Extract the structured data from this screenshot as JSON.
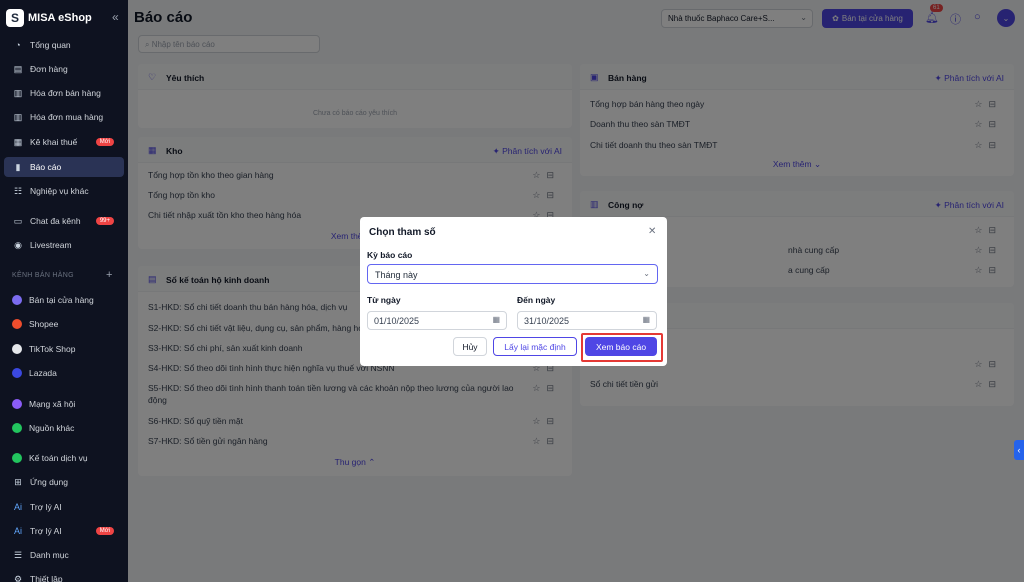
{
  "brand": {
    "logo_letter": "S",
    "name": "MISA eShop"
  },
  "sidebar": {
    "collapse_glyph": "«",
    "items": [
      {
        "label": "Tổng quan",
        "icon": "dashboard-icon"
      },
      {
        "label": "Đơn hàng",
        "icon": "order-icon"
      },
      {
        "label": "Hóa đơn bán hàng",
        "icon": "sales-invoice-icon"
      },
      {
        "label": "Hóa đơn mua hàng",
        "icon": "purchase-invoice-icon"
      },
      {
        "label": "Kê khai thuế",
        "icon": "tax-icon",
        "badge": "Mới"
      },
      {
        "label": "Báo cáo",
        "icon": "report-icon",
        "active": true
      },
      {
        "label": "Nghiệp vụ khác",
        "icon": "operations-icon"
      },
      {
        "label": "Chat đa kênh",
        "icon": "chat-icon",
        "badge": "99+"
      },
      {
        "label": "Livestream",
        "icon": "livestream-icon"
      }
    ],
    "section_label": "KÊNH BÁN HÀNG",
    "channels": [
      {
        "label": "Bán tại cửa hàng",
        "color": "#7c6cf0"
      },
      {
        "label": "Shopee",
        "color": "#ee4d2d"
      },
      {
        "label": "TikTok Shop",
        "color": "#e5e7eb"
      },
      {
        "label": "Lazada",
        "color": "#3b48e0"
      },
      {
        "label": "Mạng xã hội",
        "color": "#8b5cf6"
      },
      {
        "label": "Nguồn khác",
        "color": "#22c55e"
      }
    ],
    "bottom": [
      {
        "label": "Kế toán dịch vụ",
        "icon": "accounting-icon"
      },
      {
        "label": "Ứng dụng",
        "icon": "apps-icon"
      },
      {
        "label": "Trợ lý AI",
        "icon": "ai-assistant-icon"
      },
      {
        "label": "Trợ lý AI",
        "icon": "ai-assistant-icon",
        "badge": "Mới"
      },
      {
        "label": "Danh mục",
        "icon": "catalog-icon"
      },
      {
        "label": "Thiết lập",
        "icon": "settings-icon"
      }
    ]
  },
  "header": {
    "title": "Báo cáo",
    "store": "Nhà thuốc Baphaco Care+S...",
    "sell_button": "Bán tại cửa hàng",
    "notification_count": "61",
    "avatar_glyph": "⌄"
  },
  "search_placeholder": "Nhập tên báo cáo",
  "left_cards": {
    "favorites": {
      "title": "Yêu thích",
      "empty": "Chưa có báo cáo yêu thích"
    },
    "inventory": {
      "title": "Kho",
      "ai": "Phân tích với AI",
      "rows": [
        "Tổng hợp tồn kho theo gian hàng",
        "Tổng hợp tồn kho",
        "Chi tiết nhập xuất tồn kho theo hàng hóa"
      ],
      "more": "Xem thêm"
    },
    "ledger": {
      "title": "Sổ kế toán hộ kinh doanh",
      "rows": [
        "S1-HKD: Sổ chi tiết doanh thu bán hàng hóa, dịch vụ",
        "S2-HKD: Sổ chi tiết vật liệu, dụng cụ, sản phẩm, hàng hóa",
        "S3-HKD: Sổ chi phí, sản xuất kinh doanh",
        "S4-HKD: Sổ theo dõi tình hình thực hiện nghĩa vụ thuế với NSNN",
        "S5-HKD: Sổ theo dõi tình hình thanh toán tiền lương và các khoản nộp theo lương của người lao",
        "động",
        "S6-HKD: Sổ quỹ tiền mặt",
        "S7-HKD: Sổ tiền gửi ngân hàng"
      ],
      "collapse": "Thu gọn"
    }
  },
  "right_cards": {
    "sales": {
      "title": "Bán hàng",
      "ai": "Phân tích với AI",
      "rows": [
        "Tổng hợp bán hàng theo ngày",
        "Doanh thu theo sàn TMĐT",
        "Chi tiết doanh thu theo sàn TMĐT"
      ],
      "more": "Xem thêm"
    },
    "debt": {
      "title": "Công nợ",
      "ai": "Phân tích với AI",
      "rows": [
        "",
        "nhà cung cấp",
        "a cung cấp"
      ]
    },
    "cash": {
      "rows": [
        "",
        "Sổ chi tiết tiền gửi"
      ]
    }
  },
  "dialog": {
    "title": "Chọn tham số",
    "period_label": "Kỳ báo cáo",
    "period_value": "Tháng này",
    "from_label": "Từ ngày",
    "from_value": "01/10/2025",
    "to_label": "Đến ngày",
    "to_value": "31/10/2025",
    "cancel": "Hủy",
    "reset": "Lấy lại mặc định",
    "submit": "Xem báo cáo"
  },
  "highlight_color": "#e53935",
  "accent_color": "#4f46e5"
}
